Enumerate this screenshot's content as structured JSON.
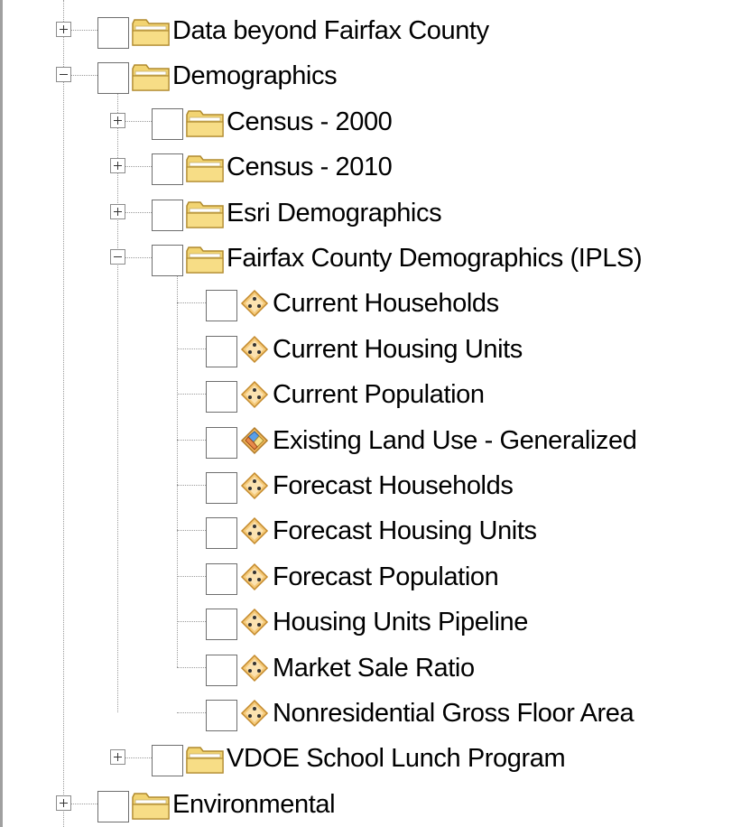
{
  "tree": {
    "top_nodes": [
      {
        "label": "Data beyond Fairfax County",
        "expander": "plus"
      },
      {
        "label": "Demographics",
        "expander": "minus"
      },
      {
        "label": "Environmental",
        "expander": "plus"
      }
    ],
    "demographics_children": [
      {
        "label": "Census - 2000",
        "expander": "plus"
      },
      {
        "label": "Census - 2010",
        "expander": "plus"
      },
      {
        "label": "Esri Demographics",
        "expander": "plus"
      },
      {
        "label": "Fairfax County Demographics (IPLS)",
        "expander": "minus"
      },
      {
        "label": "VDOE School Lunch Program",
        "expander": "plus"
      }
    ],
    "ipls_layers": [
      {
        "label": "Current Households",
        "icon": "point-layer-icon"
      },
      {
        "label": "Current Housing Units",
        "icon": "point-layer-icon"
      },
      {
        "label": "Current Population",
        "icon": "point-layer-icon"
      },
      {
        "label": "Existing Land Use - Generalized",
        "icon": "polygon-layer-icon"
      },
      {
        "label": "Forecast Households",
        "icon": "point-layer-icon"
      },
      {
        "label": "Forecast Housing Units",
        "icon": "point-layer-icon"
      },
      {
        "label": "Forecast Population",
        "icon": "point-layer-icon"
      },
      {
        "label": "Housing Units Pipeline",
        "icon": "point-layer-icon"
      },
      {
        "label": "Market Sale Ratio",
        "icon": "point-layer-icon"
      },
      {
        "label": "Nonresidential Gross Floor Area",
        "icon": "point-layer-icon"
      }
    ]
  },
  "colors": {
    "folder_body": "#f2d472",
    "folder_stroke": "#b08a2e",
    "point_layer_fill": "#f4c877",
    "point_layer_stroke": "#c48a2c"
  }
}
